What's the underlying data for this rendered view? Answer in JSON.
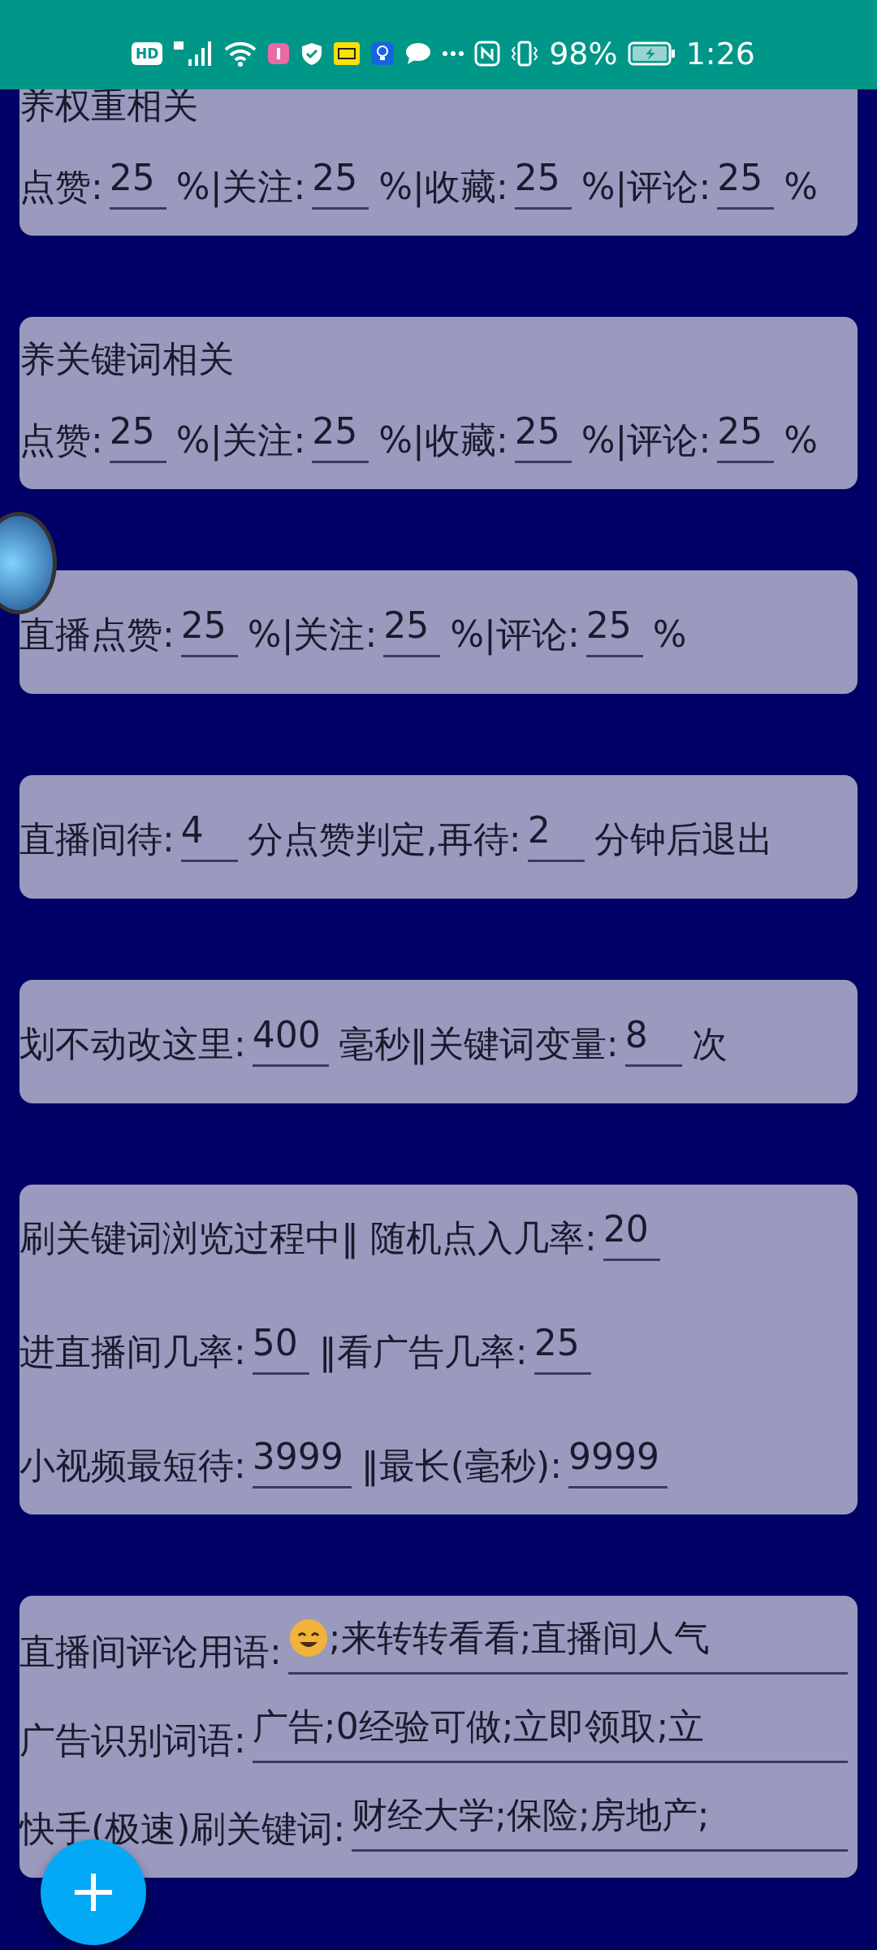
{
  "status_bar": {
    "hd": "HD",
    "battery": "98%",
    "time": "1:26"
  },
  "cards": [
    {
      "title": "养权重相关",
      "rows": [
        [
          {
            "kind": "label",
            "text": "点赞:"
          },
          {
            "kind": "field",
            "value": "25"
          },
          {
            "kind": "label",
            "text": "%|关注:"
          },
          {
            "kind": "field",
            "value": "25"
          },
          {
            "kind": "label",
            "text": "%|收藏:"
          },
          {
            "kind": "field",
            "value": "25"
          },
          {
            "kind": "label",
            "text": "%|评论:"
          },
          {
            "kind": "field",
            "value": "25"
          },
          {
            "kind": "label",
            "text": "%"
          }
        ]
      ]
    },
    {
      "title": "养关键词相关",
      "rows": [
        [
          {
            "kind": "label",
            "text": "点赞:"
          },
          {
            "kind": "field",
            "value": "25"
          },
          {
            "kind": "label",
            "text": "%|关注:"
          },
          {
            "kind": "field",
            "value": "25"
          },
          {
            "kind": "label",
            "text": "%|收藏:"
          },
          {
            "kind": "field",
            "value": "25"
          },
          {
            "kind": "label",
            "text": "%|评论:"
          },
          {
            "kind": "field",
            "value": "25"
          },
          {
            "kind": "label",
            "text": "%"
          }
        ]
      ]
    },
    {
      "rows": [
        [
          {
            "kind": "label",
            "text": "直播点赞:"
          },
          {
            "kind": "field",
            "value": "25"
          },
          {
            "kind": "label",
            "text": "%|关注:"
          },
          {
            "kind": "field",
            "value": "25"
          },
          {
            "kind": "label",
            "text": "%|评论:"
          },
          {
            "kind": "field",
            "value": "25"
          },
          {
            "kind": "label",
            "text": "%"
          }
        ]
      ]
    },
    {
      "rows": [
        [
          {
            "kind": "label",
            "text": "直播间待:"
          },
          {
            "kind": "field",
            "value": "4"
          },
          {
            "kind": "label",
            "text": "分点赞判定,再待:"
          },
          {
            "kind": "field",
            "value": "2"
          },
          {
            "kind": "label",
            "text": "分钟后退出"
          }
        ]
      ]
    },
    {
      "rows": [
        [
          {
            "kind": "label",
            "text": "划不动改这里:"
          },
          {
            "kind": "field",
            "value": "400"
          },
          {
            "kind": "label",
            "text": "毫秒‖关键词变量:"
          },
          {
            "kind": "field",
            "value": "8"
          },
          {
            "kind": "label",
            "text": "次"
          }
        ]
      ]
    },
    {
      "rows": [
        [
          {
            "kind": "label",
            "text": "刷关键词浏览过程中‖  随机点入几率:"
          },
          {
            "kind": "field",
            "value": "20"
          }
        ],
        [
          {
            "kind": "label",
            "text": "进直播间几率:"
          },
          {
            "kind": "field",
            "value": "50"
          },
          {
            "kind": "label",
            "text": "‖看广告几率:"
          },
          {
            "kind": "field",
            "value": "25"
          }
        ],
        [
          {
            "kind": "label",
            "text": "小视频最短待:"
          },
          {
            "kind": "field",
            "value": "3999"
          },
          {
            "kind": "label",
            "text": "‖最长(毫秒):"
          },
          {
            "kind": "field",
            "value": "9999"
          }
        ]
      ]
    },
    {
      "rows": [
        [
          {
            "kind": "label",
            "text": "直播间评论用语:"
          },
          {
            "kind": "emoji_textarea",
            "value": ";来转转看看;直播间人气"
          }
        ],
        [
          {
            "kind": "label",
            "text": "广告识别词语:"
          },
          {
            "kind": "textarea",
            "value": "广告;0经验可做;立即领取;立"
          }
        ],
        [
          {
            "kind": "label",
            "text": "快手(极速)刷关键词:"
          },
          {
            "kind": "textarea",
            "value": "财经大学;保险;房地产;"
          }
        ]
      ]
    }
  ]
}
